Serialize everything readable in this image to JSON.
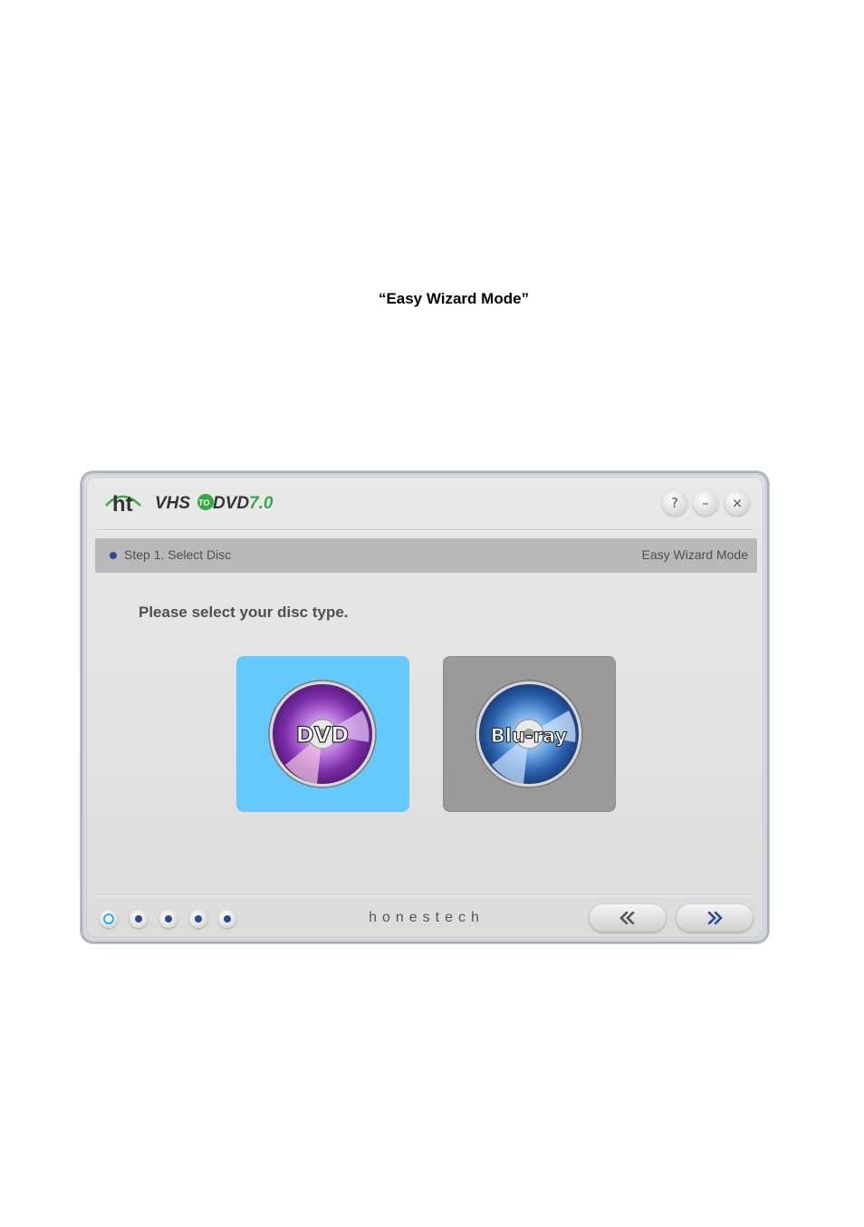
{
  "document": {
    "heading": "“Easy Wizard Mode”"
  },
  "window": {
    "logo": {
      "ht": "ht",
      "vhs": "VHS",
      "to": "TO",
      "dvd": "DVD",
      "version": "7.0"
    },
    "controls": {
      "help": "?",
      "minimize": "–",
      "close": "×"
    }
  },
  "step_bar": {
    "label": "Step 1. Select Disc",
    "mode": "Easy Wizard Mode"
  },
  "main": {
    "prompt": "Please select your disc type.",
    "options": [
      {
        "label": "DVD",
        "selected": true,
        "color": "#66c9fb"
      },
      {
        "label": "Blu-ray",
        "selected": false,
        "color": "#9a9a9a"
      }
    ]
  },
  "footer": {
    "brand": "honestech",
    "steps_total": 5,
    "current_step": 1
  },
  "colors": {
    "accent": "#2a4a8a",
    "logo_green": "#3aa648"
  }
}
